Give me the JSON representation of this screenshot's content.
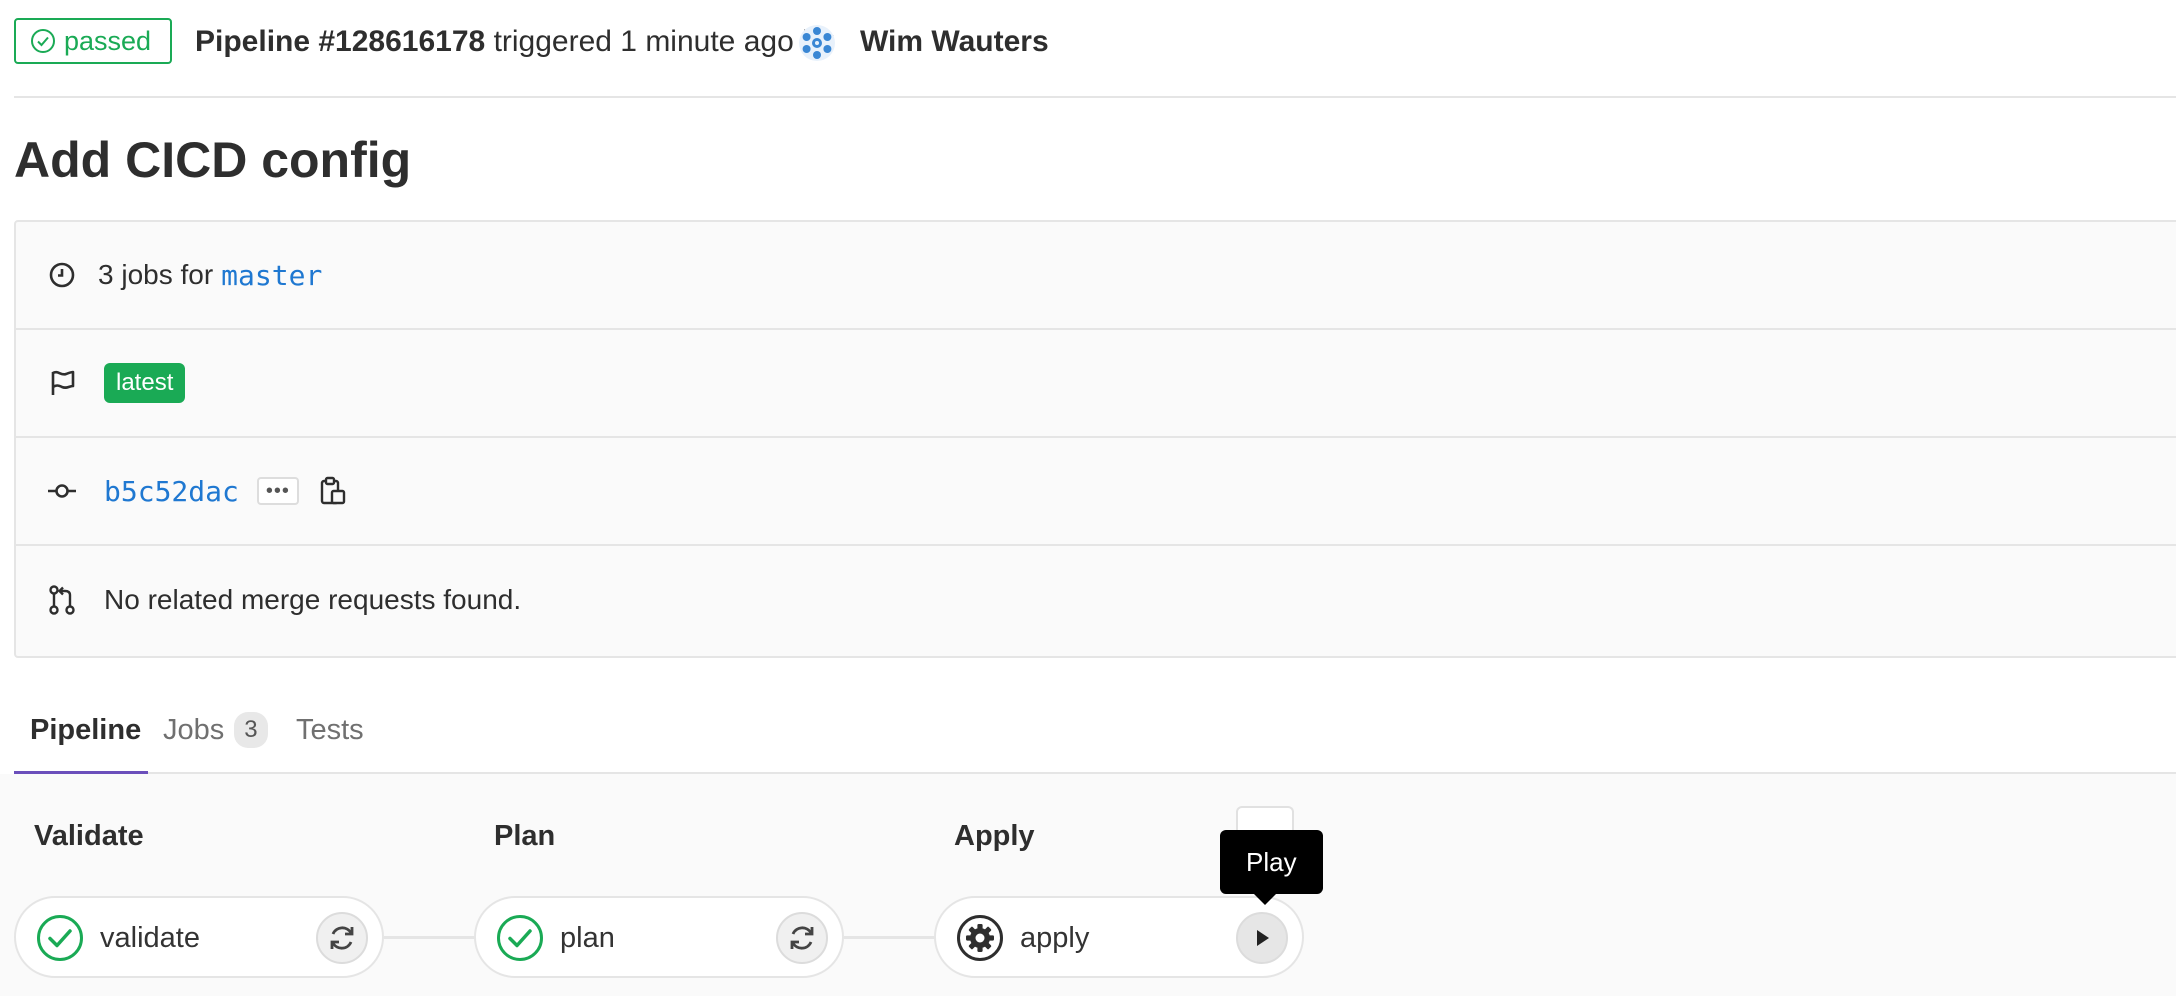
{
  "header": {
    "status": "passed",
    "pipeline_label": "Pipeline #128616178",
    "triggered_text": "triggered 1 minute ago by",
    "author": "Wim Wauters"
  },
  "title": "Add CICD config",
  "info": {
    "jobs_prefix": "3 jobs for",
    "branch": "master",
    "tag": "latest",
    "commit_sha": "b5c52dac",
    "merge_requests": "No related merge requests found."
  },
  "tabs": [
    {
      "label": "Pipeline",
      "active": true
    },
    {
      "label": "Jobs",
      "count": "3"
    },
    {
      "label": "Tests"
    }
  ],
  "stages": [
    {
      "title": "Validate",
      "job": "validate",
      "status": "success",
      "action": "retry"
    },
    {
      "title": "Plan",
      "job": "plan",
      "status": "success",
      "action": "retry"
    },
    {
      "title": "Apply",
      "job": "apply",
      "status": "manual",
      "action": "play"
    }
  ],
  "tooltip": "Play",
  "colors": {
    "success": "#1aaa55",
    "link": "#1f78d1",
    "active_tab": "#6b4fbb",
    "border": "#e5e5e5"
  }
}
